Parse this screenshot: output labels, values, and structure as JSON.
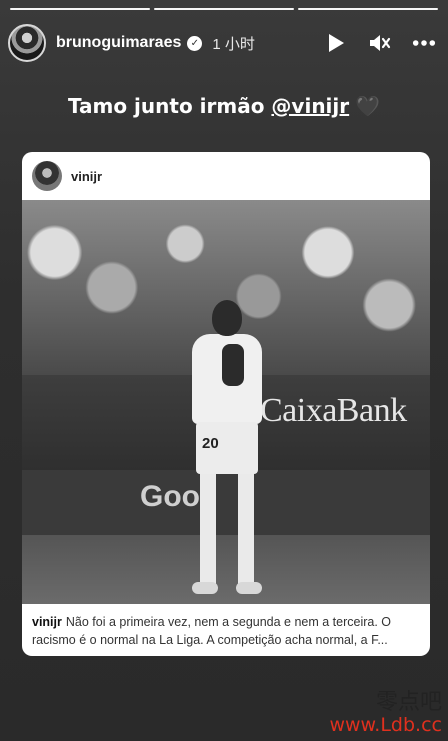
{
  "progress": {
    "total": 3,
    "done": 3
  },
  "header": {
    "username": "brunoguimaraes",
    "verified_icon": "verified-badge-icon",
    "time_ago": "1 小时",
    "icons": [
      "play-icon",
      "mute-icon",
      "more-icon"
    ]
  },
  "story": {
    "caption_text": "Tamo junto irmão ",
    "caption_mention": "@vinijr",
    "caption_emoji": "🖤"
  },
  "shared_post": {
    "username": "vinijr",
    "photo": {
      "ad_text_1": "CaixaBank",
      "ad_text_2": "Goo",
      "jersey_number": "20"
    },
    "caption_user": "vinijr",
    "caption_line_1": "Não foi a primeira vez, nem a segunda e nem a terceira. O",
    "caption_line_2": "racismo é o normal na La Liga.  A competição acha normal, a F..."
  },
  "watermark": {
    "line_1": "零点吧",
    "line_2": "www.Ldb.cc"
  },
  "colors": {
    "background": "#2e2e2e",
    "card": "#ffffff",
    "watermark_red": "#e0301e"
  }
}
